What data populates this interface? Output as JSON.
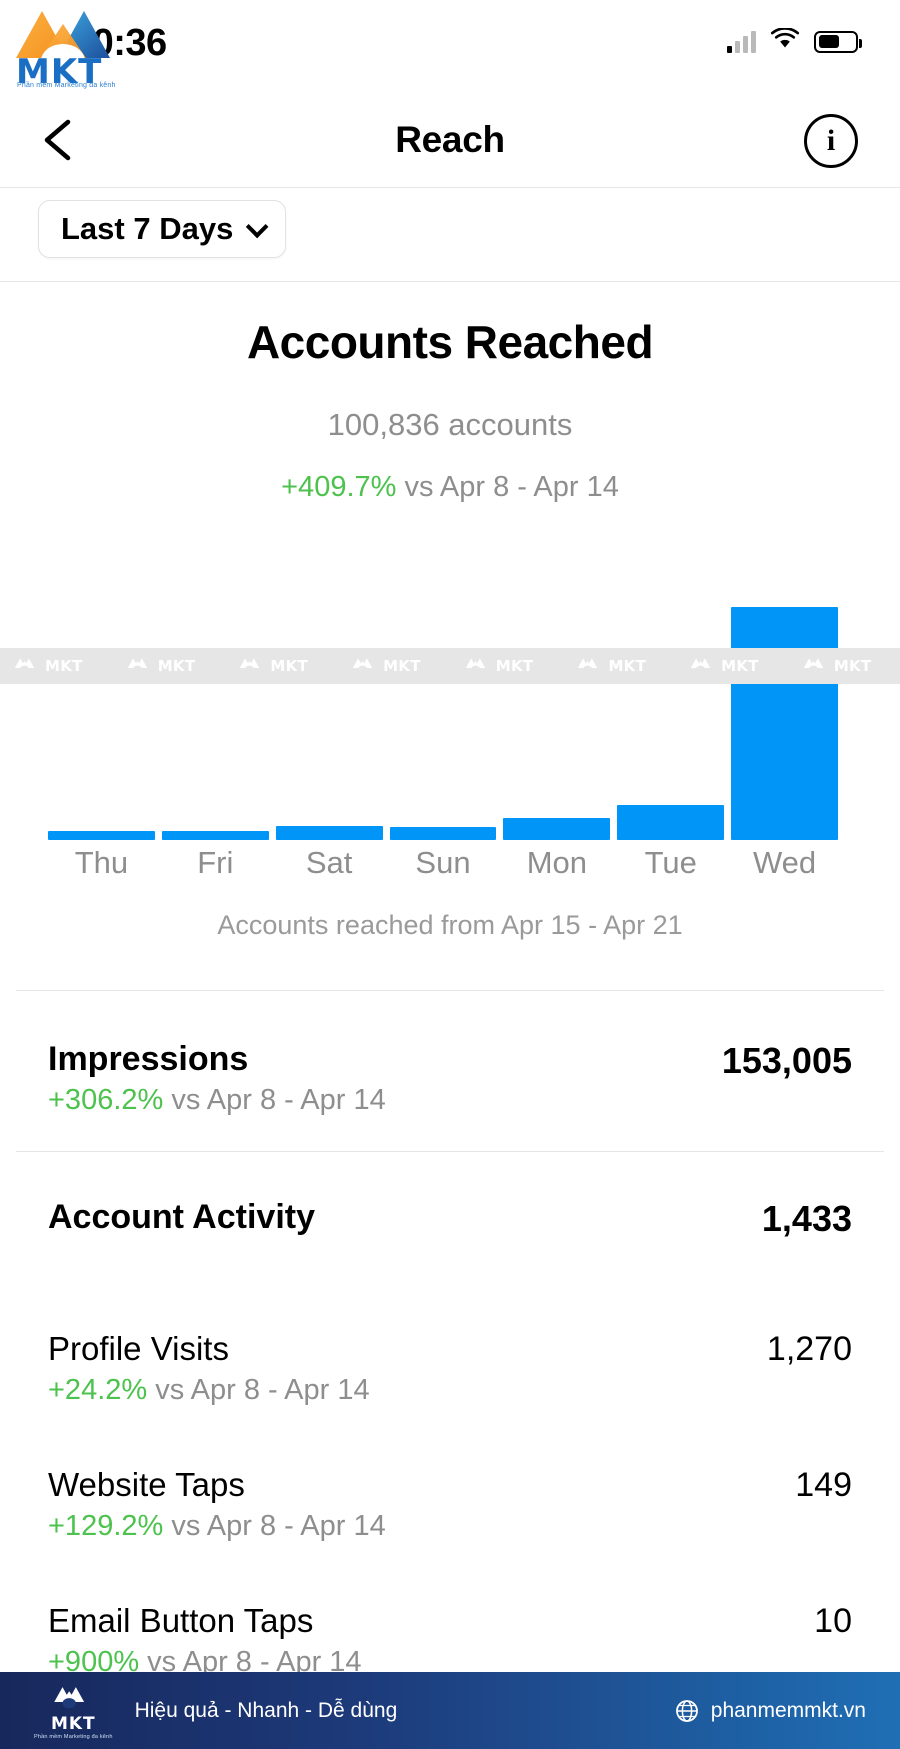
{
  "status_bar": {
    "time": "10:36",
    "signal_icon": "cellular-signal-icon",
    "wifi_icon": "wifi-icon",
    "battery_icon": "battery-icon"
  },
  "brand_overlay": {
    "word": "MKT",
    "tagline": "Phần mềm Marketing đa kênh"
  },
  "nav": {
    "back_icon": "chevron-left-icon",
    "title": "Reach",
    "info_icon": "info-icon",
    "info_glyph": "i"
  },
  "filter": {
    "label": "Last 7 Days",
    "chevron_icon": "chevron-down-icon"
  },
  "hero": {
    "title": "Accounts Reached",
    "subtitle": "100,836 accounts",
    "delta": "+409.7%",
    "delta_suffix": " vs Apr 8 - Apr 14"
  },
  "chart_data": {
    "type": "bar",
    "title": "Accounts Reached",
    "caption": "Accounts reached from Apr 15 - Apr 21",
    "categories": [
      "Thu",
      "Fri",
      "Sat",
      "Sun",
      "Mon",
      "Tue",
      "Wed"
    ],
    "values": [
      2300,
      2300,
      3600,
      3400,
      5700,
      9200,
      61000
    ],
    "bar_color": "#0095f6",
    "xlabel": "",
    "ylabel": "",
    "ylim": [
      0,
      63000
    ],
    "grid": false,
    "legend": "none",
    "total": "100,836"
  },
  "watermark": {
    "word": "MKT",
    "repeat": 9,
    "strip_color": "#e6e6e6"
  },
  "metrics": [
    {
      "name": "Impressions",
      "value": "153,005",
      "delta": "+306.2%",
      "delta_suffix": " vs Apr 8 - Apr 14",
      "level": "main"
    },
    {
      "name": "Account Activity",
      "value": "1,433",
      "delta": "",
      "delta_suffix": "",
      "level": "main"
    },
    {
      "name": "Profile Visits",
      "value": "1,270",
      "delta": "+24.2%",
      "delta_suffix": " vs Apr 8 - Apr 14",
      "level": "sub"
    },
    {
      "name": "Website Taps",
      "value": "149",
      "delta": "+129.2%",
      "delta_suffix": " vs Apr 8 - Apr 14",
      "level": "sub"
    },
    {
      "name": "Email Button Taps",
      "value": "10",
      "delta": "+900%",
      "delta_suffix": " vs Apr 8 - Apr 14",
      "level": "sub"
    }
  ],
  "footer": {
    "logo_word": "MKT",
    "logo_sub": "Phần mềm Marketing đa kênh",
    "slogan": "Hiệu quả - Nhanh - Dễ dùng",
    "globe_icon": "globe-icon",
    "url": "phanmemmkt.vn"
  },
  "colors": {
    "accent_blue": "#0095f6",
    "positive_green": "#4ec24e",
    "muted_gray": "#8e8e8e"
  }
}
